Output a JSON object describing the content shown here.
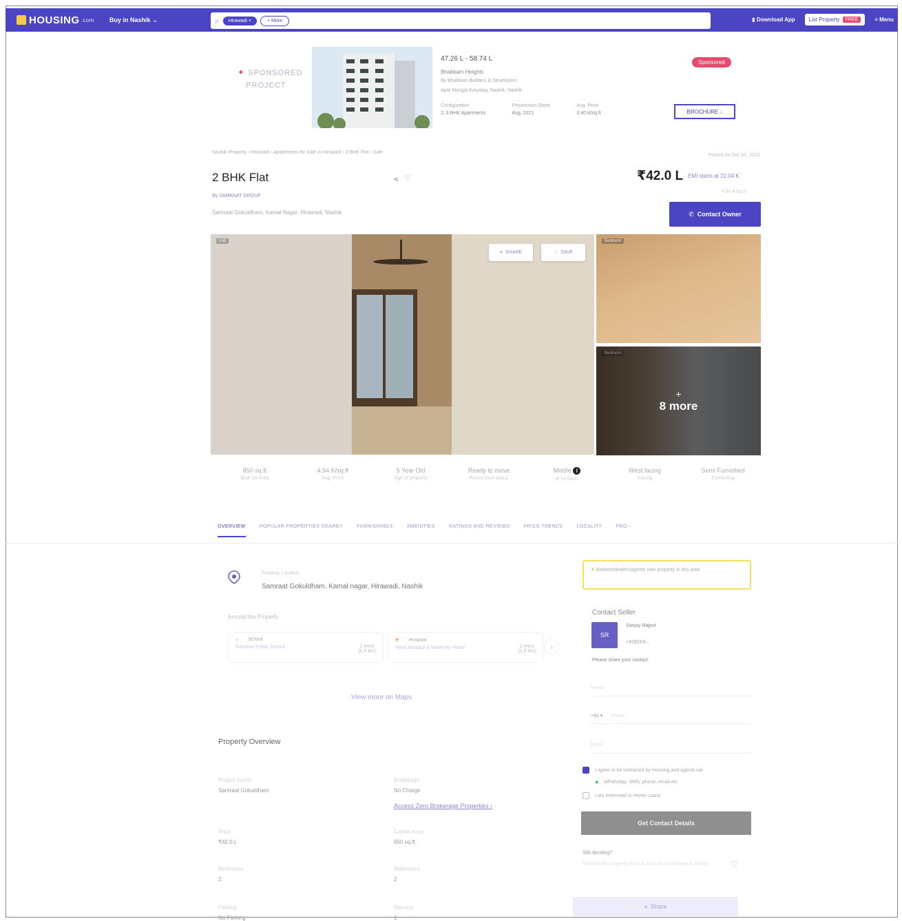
{
  "header": {
    "logo": "HOUSING",
    "logo_suffix": ".com",
    "buy_in": "Buy in Nashik",
    "search_chip": "Hirawadi",
    "search_chip_close": "×",
    "search_chip_outline": "+ More",
    "download_app": "Download App",
    "post_property": "List Property",
    "free_tag": "FREE",
    "menu": "Menu"
  },
  "sponsored": {
    "label_line1": "SPONSORED",
    "label_line2": "PROJECT",
    "price_range": "47.26 L - 58.74 L",
    "project_name": "Bhakkam Heights",
    "builder": "By Bhakkam Builders & Developers",
    "location": "Apte Mangal Karyalay, Nashik, Nashik",
    "facts": [
      {
        "k": "Configuration",
        "v": "2, 3 BHK Apartments"
      },
      {
        "k": "Possession Starts",
        "v": "Aug, 2021"
      },
      {
        "k": "Avg. Price",
        "v": "3.40 K/sq.ft"
      }
    ],
    "badge": "Sponsored",
    "download_btn": "BROCHURE ↓"
  },
  "breadcrumb": "Nashik Property › Hirawadi › Apartments for Sale in Hirawadi › 2 BHK Flat › Sale",
  "posted_on": "Posted on Dec 01, 2023",
  "listing": {
    "title": "2 BHK Flat",
    "builder": "By SAMRAAT GROUP",
    "address": "Samraat Gokuldham, Kamal Nagar, Hirawadi, Nashik",
    "price": "₹42.0 L",
    "emi": "EMI starts at 22.04 K",
    "per_sqft": "4.94 K/sq.ft",
    "contact_owner": "Contact Owner"
  },
  "gallery": {
    "main_tag": "Hall",
    "top_tag": "Bedroom",
    "bottom_tag": "Bedroom",
    "share": "SHARE",
    "save": "SAVE",
    "more_plus": "+",
    "more": "8 more"
  },
  "highlights": [
    {
      "value": "850 sq.ft",
      "label": "Built Up Area"
    },
    {
      "value": "4.94 K/sq.ft",
      "label": "Avg. Price"
    },
    {
      "value": "5 Year Old",
      "label": "Age of property"
    },
    {
      "value": "Ready to move",
      "label": "Possession status"
    },
    {
      "value": "Middle",
      "label": "of 14 floors"
    },
    {
      "value": "West facing",
      "label": "Facing"
    },
    {
      "value": "Semi Furnished",
      "label": "Furnishing"
    }
  ],
  "tabs": [
    "OVERVIEW",
    "POPULAR PROPERTIES NEARBY",
    "FURNISHINGS",
    "AMENITIES",
    "RATINGS AND REVIEWS",
    "PRICE TRENDS",
    "LOCALITY",
    "PRO ›"
  ],
  "location": {
    "label": "Property Location",
    "address": "Samraat Gokuldham, Kamal nagar, Hirawadi, Nashik",
    "around_title": "Around this Property",
    "nearby": [
      {
        "category": "School",
        "name": "Rainbow Public School",
        "dist": "2 mins",
        "dist_sub": "(0.6 km)"
      },
      {
        "category": "Hospital",
        "name": "Nima Hospital & Maternity Home",
        "dist": "2 mins",
        "dist_sub": "(0.8 km)"
      }
    ],
    "view_maps": "View more on Maps"
  },
  "overview": {
    "title": "Property Overview",
    "items": [
      {
        "k": "Project Name",
        "v": "Samraat Gokuldham"
      },
      {
        "k": "Brokerage",
        "v": "No Charge"
      },
      {
        "k": "Price",
        "v": "₹42.0 L"
      },
      {
        "k": "Carpet Area",
        "v": "650 sq.ft"
      },
      {
        "k": "Bedrooms",
        "v": "2"
      },
      {
        "k": "Bathrooms",
        "v": "2"
      },
      {
        "k": "Parking",
        "v": "No Parking"
      },
      {
        "k": "Balcony",
        "v": "1"
      }
    ],
    "link": "Access Zero Brokerage Properties ›"
  },
  "seller": {
    "dealer_note": "Brokers/dealers/agents own property in this area",
    "heading": "Contact Seller",
    "avatar_initials": "SR",
    "name": "Sanjay Rajput",
    "phone": "+9182XX...",
    "share_prompt": "Please share your contact",
    "name_placeholder": "Name",
    "phone_code": "+91 ▾",
    "phone_placeholder": "Phone",
    "email_placeholder": "Email",
    "agree_text": "I agree to be contacted by Housing and agents via",
    "whatsapp_text": "WhatsApp, SMS, phone, email etc",
    "loan_text": "I am interested in Home Loans",
    "get_contact": "Get Contact Details",
    "still_deciding": "Still deciding?",
    "still_sub": "Shortlist this property for now & easily come back to it later",
    "share": "Share"
  },
  "colors": {
    "brand": "#4b45c3",
    "accent": "#e64a6e",
    "disabled_button": "#8f8f8f"
  }
}
